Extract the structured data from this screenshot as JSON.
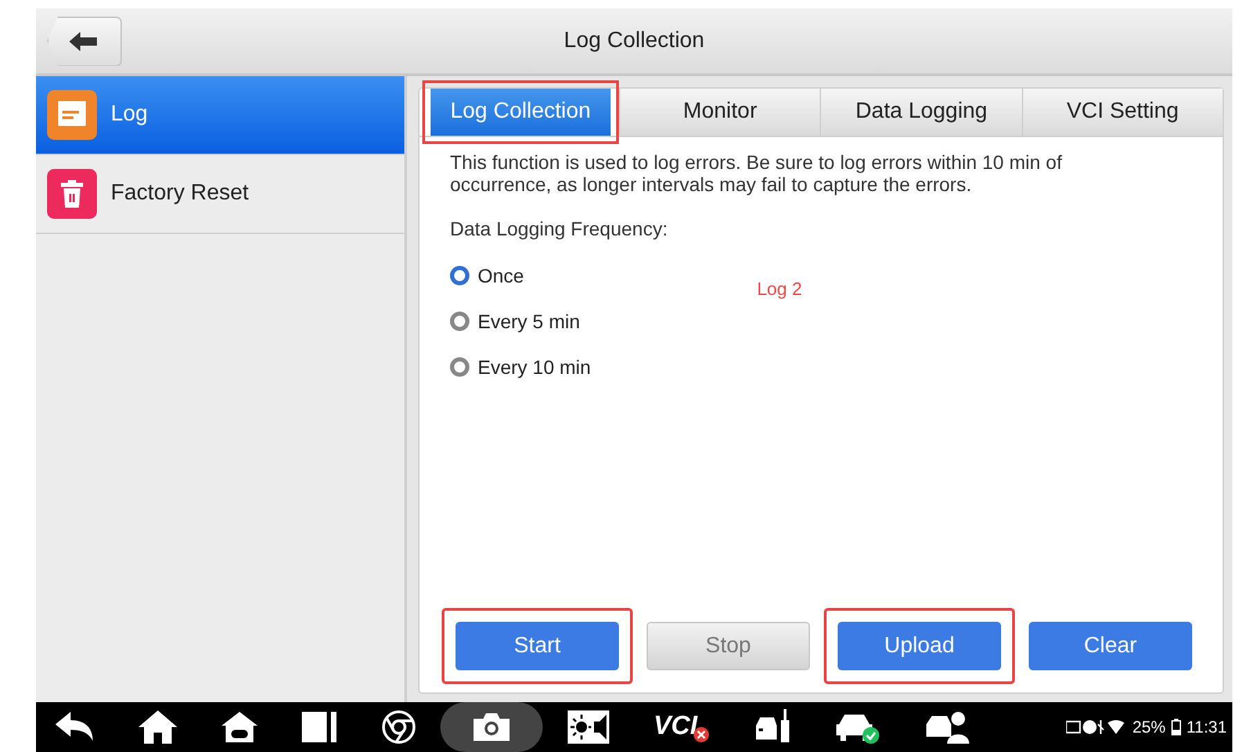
{
  "window": {
    "title": "Log Collection"
  },
  "sidebar": {
    "items": [
      {
        "label": "Log",
        "kind": "log",
        "selected": true
      },
      {
        "label": "Factory Reset",
        "kind": "reset",
        "selected": false
      }
    ]
  },
  "tabs": [
    {
      "label": "Log Collection",
      "selected": true,
      "highlighted": true
    },
    {
      "label": "Monitor",
      "selected": false,
      "highlighted": false
    },
    {
      "label": "Data Logging",
      "selected": false,
      "highlighted": false
    },
    {
      "label": "VCI Setting",
      "selected": false,
      "highlighted": false
    }
  ],
  "description": "This function is used to log errors. Be sure to log errors within 10 min of occurrence, as longer intervals may fail to capture the errors.",
  "frequency_label": "Data Logging Frequency:",
  "options": [
    {
      "label": "Once",
      "selected": true
    },
    {
      "label": "Every 5 min",
      "selected": false
    },
    {
      "label": "Every 10 min",
      "selected": false
    }
  ],
  "annotation": "Log 2",
  "buttons": [
    {
      "label": "Start",
      "disabled": false,
      "highlighted": true
    },
    {
      "label": "Stop",
      "disabled": true,
      "highlighted": false
    },
    {
      "label": "Upload",
      "disabled": false,
      "highlighted": true
    },
    {
      "label": "Clear",
      "disabled": false,
      "highlighted": false
    }
  ],
  "navbar": {
    "vci_label": "VCI",
    "battery": "25%",
    "time": "11:31"
  }
}
